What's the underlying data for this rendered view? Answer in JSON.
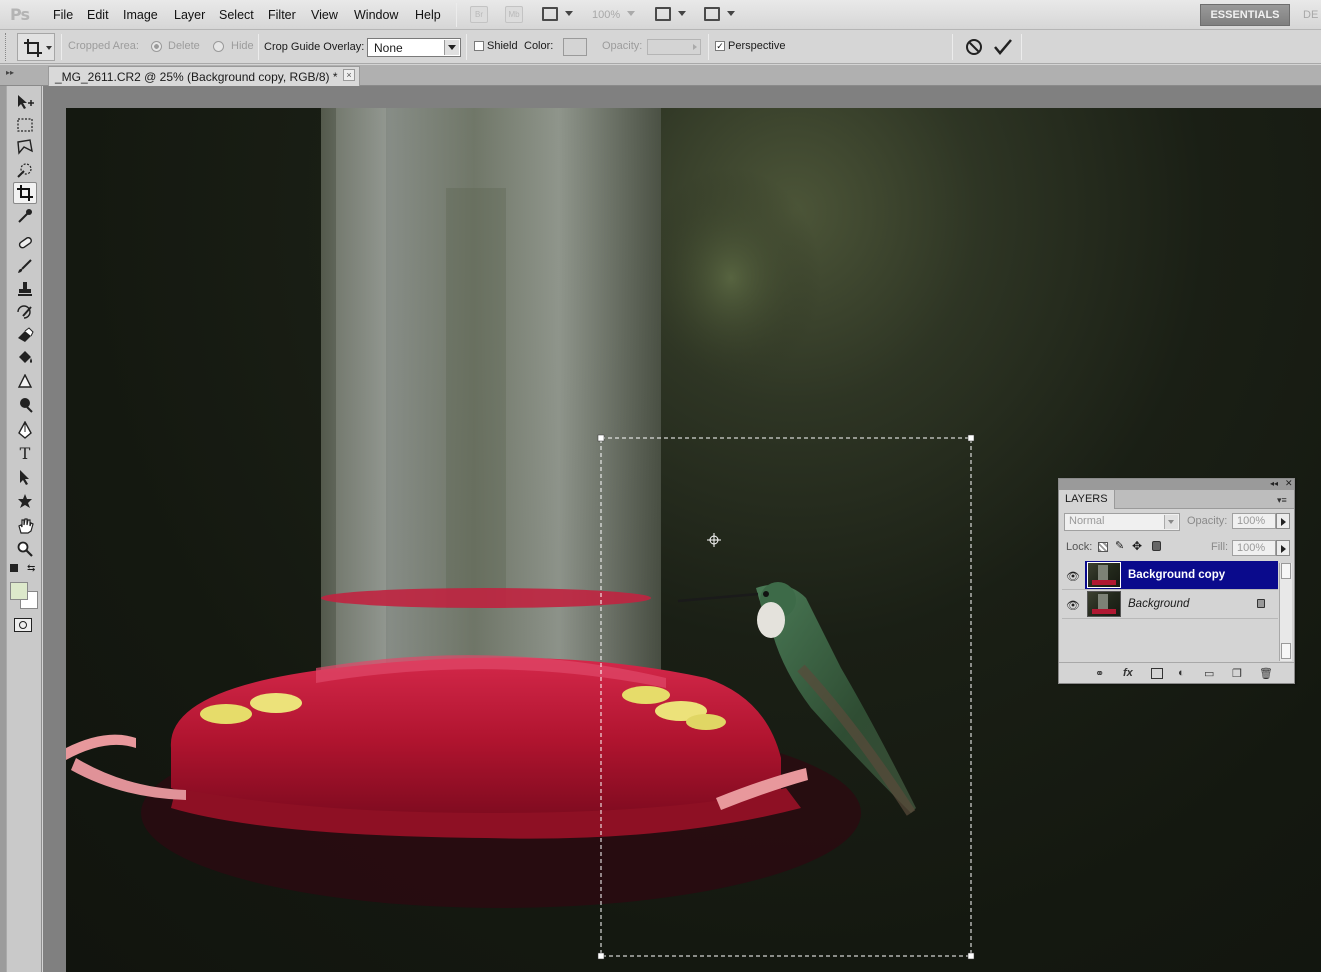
{
  "app": {
    "logo": "Ps"
  },
  "menu": {
    "items": [
      "File",
      "Edit",
      "Image",
      "Layer",
      "Select",
      "Filter",
      "View",
      "Window",
      "Help"
    ],
    "bridge_btn": "Br",
    "minibridge_btn": "Mb",
    "zoom": "100%",
    "workspace_active": "ESSENTIALS",
    "workspace_next": "DE"
  },
  "options": {
    "cropped_area_label": "Cropped Area:",
    "delete_label": "Delete",
    "hide_label": "Hide",
    "overlay_label": "Crop Guide Overlay:",
    "overlay_value": "None",
    "shield_label": "Shield",
    "color_label": "Color:",
    "opacity_label": "Opacity:",
    "perspective_label": "Perspective",
    "perspective_checked": true,
    "cancel_icon": "cancel-circle-icon",
    "commit_icon": "checkmark-icon"
  },
  "document": {
    "tab_title": "_MG_2611.CR2 @ 25% (Background copy, RGB/8) *",
    "close_glyph": "×"
  },
  "tools": [
    "move-tool",
    "marquee-tool",
    "lasso-tool",
    "quick-selection-tool",
    "crop-tool",
    "eyedropper-tool",
    "spot-healing-tool",
    "brush-tool",
    "clone-stamp-tool",
    "history-brush-tool",
    "eraser-tool",
    "paint-bucket-tool",
    "blur-tool",
    "dodge-tool",
    "pen-tool",
    "type-tool",
    "path-selection-tool",
    "custom-shape-tool",
    "hand-tool",
    "zoom-tool"
  ],
  "colors": {
    "foreground": "#dde9cb",
    "background": "#ffffff",
    "selected_layer": "#0a0a8c",
    "feeder_red": "#b21832",
    "photo_bg": "#141810"
  },
  "layers_panel": {
    "title": "LAYERS",
    "blend_mode": "Normal",
    "opacity_label": "Opacity:",
    "opacity_value": "100%",
    "lock_label": "Lock:",
    "fill_label": "Fill:",
    "fill_value": "100%",
    "layers": [
      {
        "name": "Background copy",
        "selected": true,
        "locked": false
      },
      {
        "name": "Background",
        "selected": false,
        "locked": true
      }
    ]
  }
}
